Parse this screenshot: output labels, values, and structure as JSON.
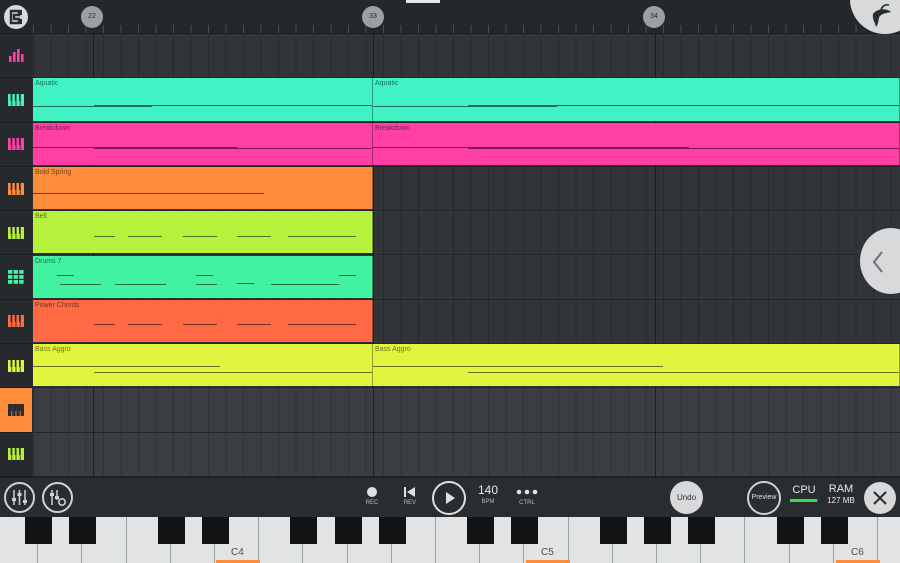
{
  "ruler": {
    "bar_markers": [
      "22",
      "33",
      "34"
    ]
  },
  "tracks": [
    {
      "id": "mixer",
      "icon": "mixer-bars-icon",
      "color": "#ff3fa4"
    },
    {
      "id": "aquatic",
      "icon": "piano-keys-icon",
      "color": "#41f2c4"
    },
    {
      "id": "breakdown",
      "icon": "piano-keys-icon",
      "color": "#ff3fa4"
    },
    {
      "id": "bold-spring",
      "icon": "piano-keys-icon",
      "color": "#ff8c3a"
    },
    {
      "id": "bell",
      "icon": "piano-keys-icon",
      "color": "#b6f23c"
    },
    {
      "id": "drums",
      "icon": "drum-pads-icon",
      "color": "#41f2a0"
    },
    {
      "id": "power-chords",
      "icon": "piano-keys-icon",
      "color": "#ff6a44"
    },
    {
      "id": "bass-aggro",
      "icon": "piano-keys-icon",
      "color": "#e2f53e"
    },
    {
      "id": "selected",
      "icon": "piano-keys-icon",
      "color": "#2b2e31"
    },
    {
      "id": "empty",
      "icon": "piano-keys-icon",
      "color": "#b6f23c"
    }
  ],
  "clips": [
    {
      "track": 1,
      "label": "Aquatic",
      "color": "#41f2c4",
      "start": 0,
      "end": 1
    },
    {
      "track": 1,
      "label": "Aquatic",
      "color": "#41f2c4",
      "start": 1,
      "end": 2.55
    },
    {
      "track": 2,
      "label": "Breakdown",
      "color": "#ff3fa4",
      "start": 0,
      "end": 1
    },
    {
      "track": 2,
      "label": "Breakdown",
      "color": "#ff3fa4",
      "start": 1,
      "end": 2.55
    },
    {
      "track": 3,
      "label": "Bold Spring",
      "color": "#ff8c3a",
      "start": 0,
      "end": 1
    },
    {
      "track": 4,
      "label": "Bell",
      "color": "#b6f23c",
      "start": 0,
      "end": 1
    },
    {
      "track": 5,
      "label": "Drums 7",
      "color": "#41f2a0",
      "start": 0,
      "end": 1
    },
    {
      "track": 6,
      "label": "Power Chords",
      "color": "#ff6a44",
      "start": 0,
      "end": 1
    },
    {
      "track": 7,
      "label": "Bass Aggro",
      "color": "#e2f53e",
      "start": 0,
      "end": 1
    },
    {
      "track": 7,
      "label": "Bass Aggro",
      "color": "#e2f53e",
      "start": 1,
      "end": 2.55
    }
  ],
  "transport": {
    "rec_label": "REC",
    "rev_label": "REV",
    "bpm_value": "140",
    "bpm_label": "BPM",
    "ctrl_label": "CTRL",
    "undo_label": "Undo",
    "preview_label": "Preview",
    "cpu_label": "CPU",
    "ram_label": "RAM",
    "ram_value": "127 MB",
    "cpu_level": 0.95
  },
  "piano": {
    "octave_labels": [
      "C4",
      "C5",
      "C6"
    ]
  },
  "colors": {
    "accent": "#ff8c3a",
    "cpu_meter": "#3ddc57"
  }
}
